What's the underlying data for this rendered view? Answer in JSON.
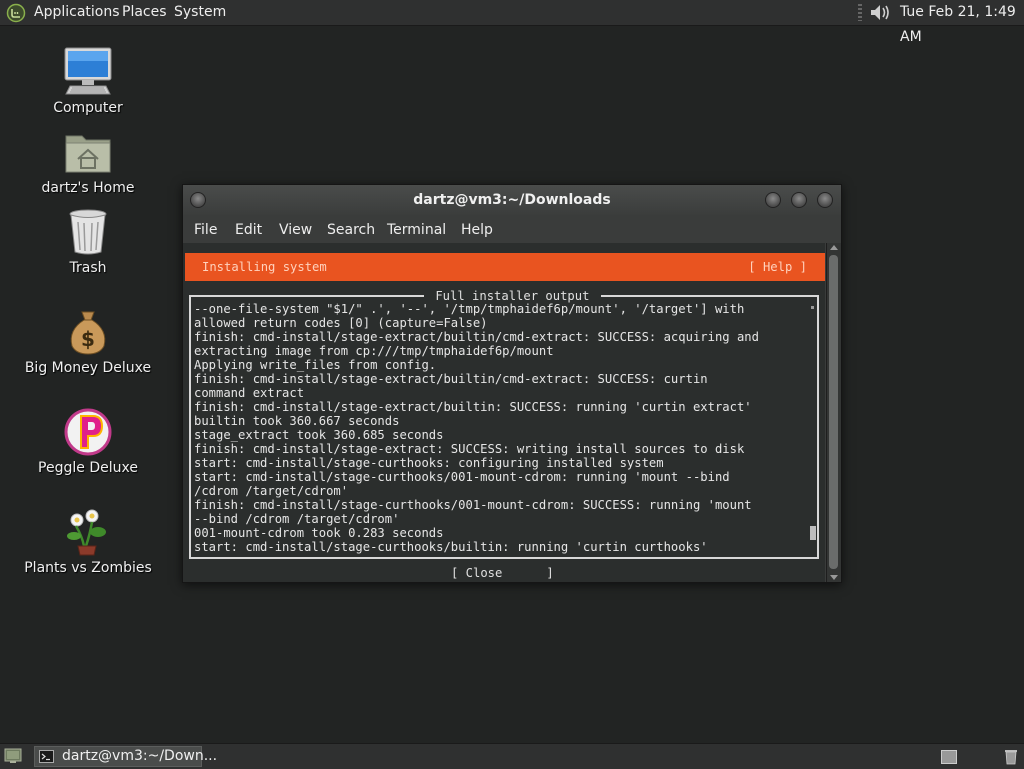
{
  "top_panel": {
    "menus": [
      "Applications",
      "Places",
      "System"
    ],
    "clock": "Tue Feb 21,  1:49 AM"
  },
  "desktop_icons": [
    {
      "label": "Computer",
      "icon": "computer-icon"
    },
    {
      "label": "dartz's Home",
      "icon": "home-folder-icon"
    },
    {
      "label": "Trash",
      "icon": "trash-icon"
    },
    {
      "label": "Big Money Deluxe",
      "icon": "money-bag-icon"
    },
    {
      "label": "Peggle Deluxe",
      "icon": "peggle-icon"
    },
    {
      "label": "Plants vs Zombies",
      "icon": "plants-zombies-icon"
    }
  ],
  "window": {
    "title": "dartz@vm3:~/Downloads",
    "menu": [
      "File",
      "Edit",
      "View",
      "Search",
      "Terminal",
      "Help"
    ]
  },
  "installer": {
    "header_title": "Installing system",
    "help": "[ Help ]",
    "frame_title": " Full installer output ",
    "lines": [
      "--one-file-system \"$1/\" .', '--', '/tmp/tmphaidef6p/mount', '/target'] with",
      "allowed return codes [0] (capture=False)",
      "finish: cmd-install/stage-extract/builtin/cmd-extract: SUCCESS: acquiring and",
      "extracting image from cp:///tmp/tmphaidef6p/mount",
      "Applying write_files from config.",
      "finish: cmd-install/stage-extract/builtin/cmd-extract: SUCCESS: curtin",
      "command extract",
      "finish: cmd-install/stage-extract/builtin: SUCCESS: running 'curtin extract'",
      "builtin took 360.667 seconds",
      "stage_extract took 360.685 seconds",
      "finish: cmd-install/stage-extract: SUCCESS: writing install sources to disk",
      "start: cmd-install/stage-curthooks: configuring installed system",
      "start: cmd-install/stage-curthooks/001-mount-cdrom: running 'mount --bind",
      "/cdrom /target/cdrom'",
      "finish: cmd-install/stage-curthooks/001-mount-cdrom: SUCCESS: running 'mount",
      "--bind /cdrom /target/cdrom'",
      "001-mount-cdrom took 0.283 seconds",
      "start: cmd-install/stage-curthooks/builtin: running 'curtin curthooks'"
    ],
    "close": "[ Close      ]"
  },
  "bottom_panel": {
    "task_label": "dartz@vm3:~/Down..."
  },
  "colors": {
    "accent": "#e95420",
    "desktop": "#222423",
    "terminal_bg": "#2b2e2d"
  }
}
